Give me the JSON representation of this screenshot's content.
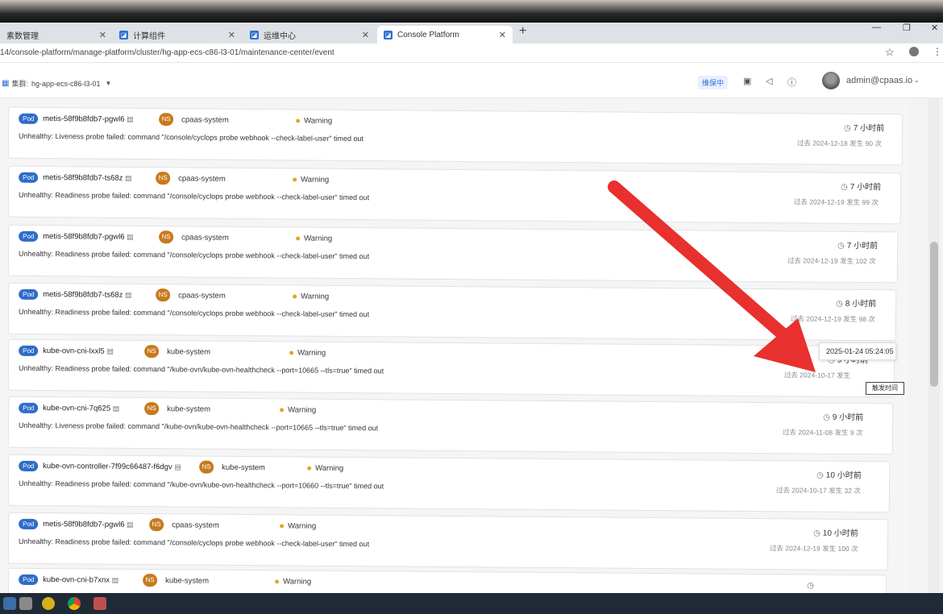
{
  "browser": {
    "tabs": [
      {
        "label": "素数管理",
        "active": false
      },
      {
        "label": "计算组件",
        "active": false
      },
      {
        "label": "运维中心",
        "active": false
      },
      {
        "label": "Console Platform",
        "active": true
      }
    ],
    "new_tab": "+",
    "url": "14/console-platform/manage-platform/cluster/hg-app-ecs-c86-l3-01/maintenance-center/event"
  },
  "header": {
    "cluster_label": "集群:",
    "cluster_value": "hg-app-ecs-c86-l3-01",
    "badge": "维保中",
    "user": "admin@cpaas.io"
  },
  "events": [
    {
      "kind": "Pod",
      "name": "metis-58f9b8fdb7-pgwl6",
      "ns_tag": "NS",
      "namespace": "cpaas-system",
      "level": "Warning",
      "message": "Unhealthy: Liveness probe failed: command \"/console/cyclops probe webhook --check-label-user\" timed out",
      "ago": "7 小时前",
      "since": "过去 2024-12-18 发生 90 次"
    },
    {
      "kind": "Pod",
      "name": "metis-58f9b8fdb7-ts68z",
      "ns_tag": "NS",
      "namespace": "cpaas-system",
      "level": "Warning",
      "message": "Unhealthy: Readiness probe failed: command \"/console/cyclops probe webhook --check-label-user\" timed out",
      "ago": "7 小时前",
      "since": "过去 2024-12-19 发生 99 次"
    },
    {
      "kind": "Pod",
      "name": "metis-58f9b8fdb7-pgwl6",
      "ns_tag": "NS",
      "namespace": "cpaas-system",
      "level": "Warning",
      "message": "Unhealthy: Readiness probe failed: command \"/console/cyclops probe webhook --check-label-user\" timed out",
      "ago": "7 小时前",
      "since": "过去 2024-12-19 发生 102 次"
    },
    {
      "kind": "Pod",
      "name": "metis-58f9b8fdb7-ts68z",
      "ns_tag": "NS",
      "namespace": "cpaas-system",
      "level": "Warning",
      "message": "Unhealthy: Readiness probe failed: command \"/console/cyclops probe webhook --check-label-user\" timed out",
      "ago": "8 小时前",
      "since": "过去 2024-12-19 发生 98 次"
    },
    {
      "kind": "Pod",
      "name": "kube-ovn-cni-lxxl5",
      "ns_tag": "NS",
      "namespace": "kube-system",
      "level": "Warning",
      "message": "Unhealthy: Readiness probe failed: command \"/kube-ovn/kube-ovn-healthcheck --port=10665 --tls=true\" timed out",
      "ago": "9 小时前",
      "since": "过去 2024-10-17 发生"
    },
    {
      "kind": "Pod",
      "name": "kube-ovn-cni-7q625",
      "ns_tag": "NS",
      "namespace": "kube-system",
      "level": "Warning",
      "message": "Unhealthy: Liveness probe failed: command \"/kube-ovn/kube-ovn-healthcheck --port=10665 --tls=true\" timed out",
      "ago": "9 小时前",
      "since": "过去 2024-11-08 发生 9 次"
    },
    {
      "kind": "Pod",
      "name": "kube-ovn-controller-7f99c66487-f6dgv",
      "ns_tag": "NS",
      "namespace": "kube-system",
      "level": "Warning",
      "message": "Unhealthy: Readiness probe failed: command \"/kube-ovn/kube-ovn-healthcheck --port=10660 --tls=true\" timed out",
      "ago": "10 小时前",
      "since": "过去 2024-10-17 发生 32 次"
    },
    {
      "kind": "Pod",
      "name": "metis-58f9b8fdb7-pgwl6",
      "ns_tag": "NS",
      "namespace": "cpaas-system",
      "level": "Warning",
      "message": "Unhealthy: Readiness probe failed: command \"/console/cyclops probe webhook --check-label-user\" timed out",
      "ago": "10 小时前",
      "since": "过去 2024-12-19 发生 100 次"
    },
    {
      "kind": "Pod",
      "name": "kube-ovn-cni-b7xnx",
      "ns_tag": "NS",
      "namespace": "kube-system",
      "level": "Warning",
      "message": "",
      "ago": "",
      "since": ""
    }
  ],
  "tooltip_time": "2025-01-24 05:24:05",
  "tooltip_label": "触发时间",
  "colors": {
    "pod_tag": "#2f6cc9",
    "ns_tag": "#c8791c",
    "warning_dot": "#e7a227",
    "annotation_arrow": "#e8302e"
  }
}
